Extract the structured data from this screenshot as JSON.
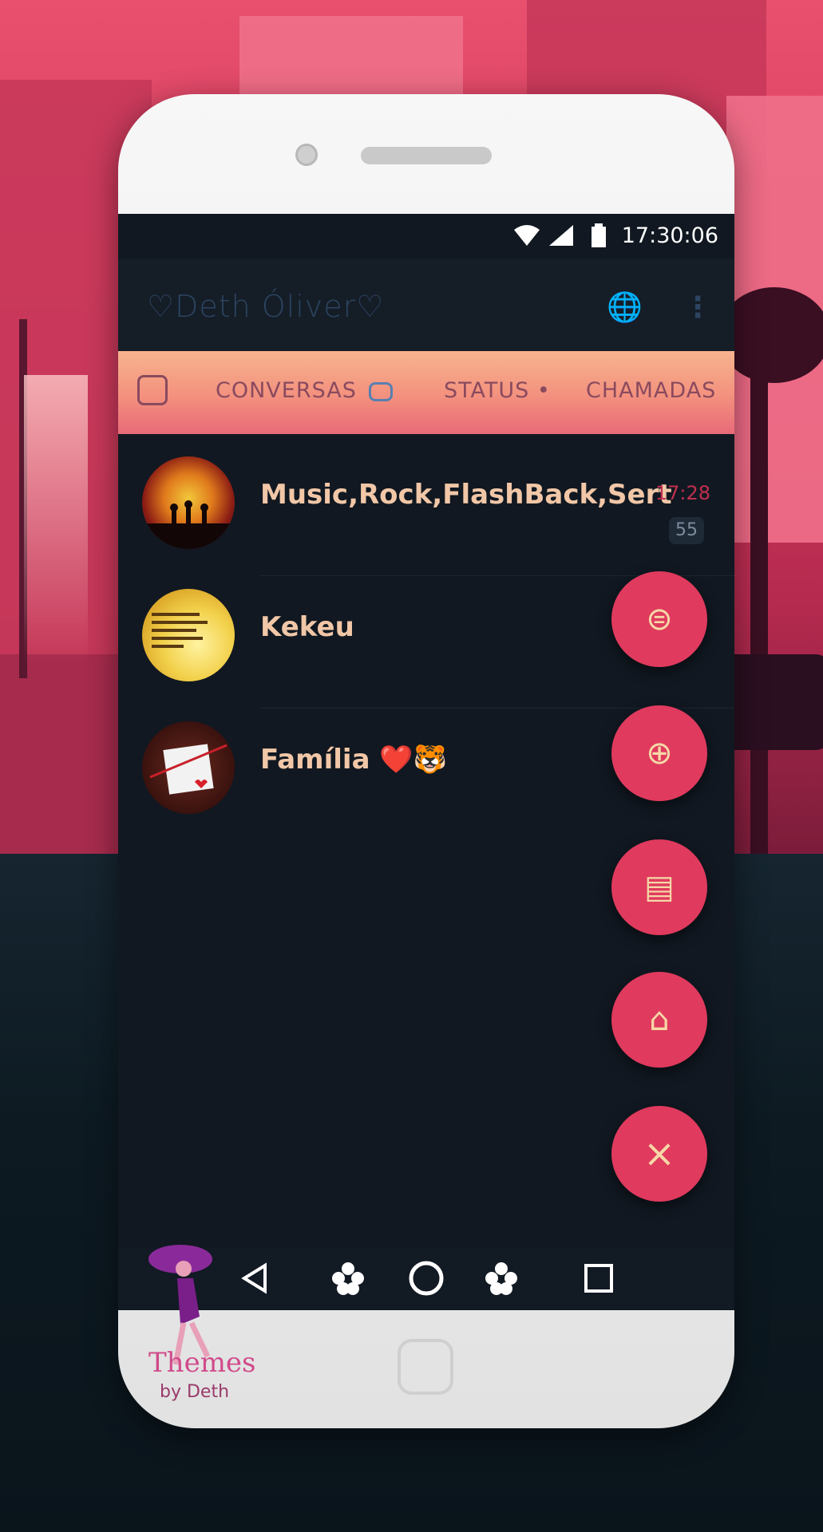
{
  "status_bar": {
    "time": "17:30:06",
    "icons": [
      "wifi-icon",
      "signal-icon",
      "battery-icon"
    ]
  },
  "app_bar": {
    "title": "♡Deth Óliver♡",
    "icons": [
      "globe-icon",
      "more-vert-icon"
    ]
  },
  "tabs": [
    {
      "label": "CONVERSAS",
      "icon": "chat-bubble-icon",
      "active": true
    },
    {
      "label": "STATUS",
      "dot": "•"
    },
    {
      "label": "CHAMADAS"
    }
  ],
  "chats": [
    {
      "name": "Music,Rock,FlashBack,Sert",
      "time": "17:28",
      "unread": "55"
    },
    {
      "name": "Kekeu",
      "time": "",
      "unread": ""
    },
    {
      "name": "Família ❤️🐯",
      "time": "",
      "unread": ""
    }
  ],
  "fab_menu": [
    {
      "name": "new-chat-fab",
      "icon": "message-icon",
      "glyph": "⊜"
    },
    {
      "name": "new-status-fab",
      "icon": "status-icon",
      "glyph": "⊕"
    },
    {
      "name": "notes-fab",
      "icon": "document-icon",
      "glyph": "▤"
    },
    {
      "name": "theme-fab",
      "icon": "paint-roller-icon",
      "glyph": "⌂"
    },
    {
      "name": "close-fab",
      "icon": "close-icon",
      "glyph": "×"
    }
  ],
  "nav_bar": {
    "icons": [
      "back-icon",
      "flower-icon",
      "home-icon",
      "flower-icon",
      "recents-icon"
    ]
  },
  "watermark": {
    "title": "Themes",
    "subtitle": "by Deth"
  },
  "colors": {
    "accent": "#e03a5e",
    "background": "#111821",
    "chat_name": "#f1c7a7",
    "time": "#c0304e"
  }
}
